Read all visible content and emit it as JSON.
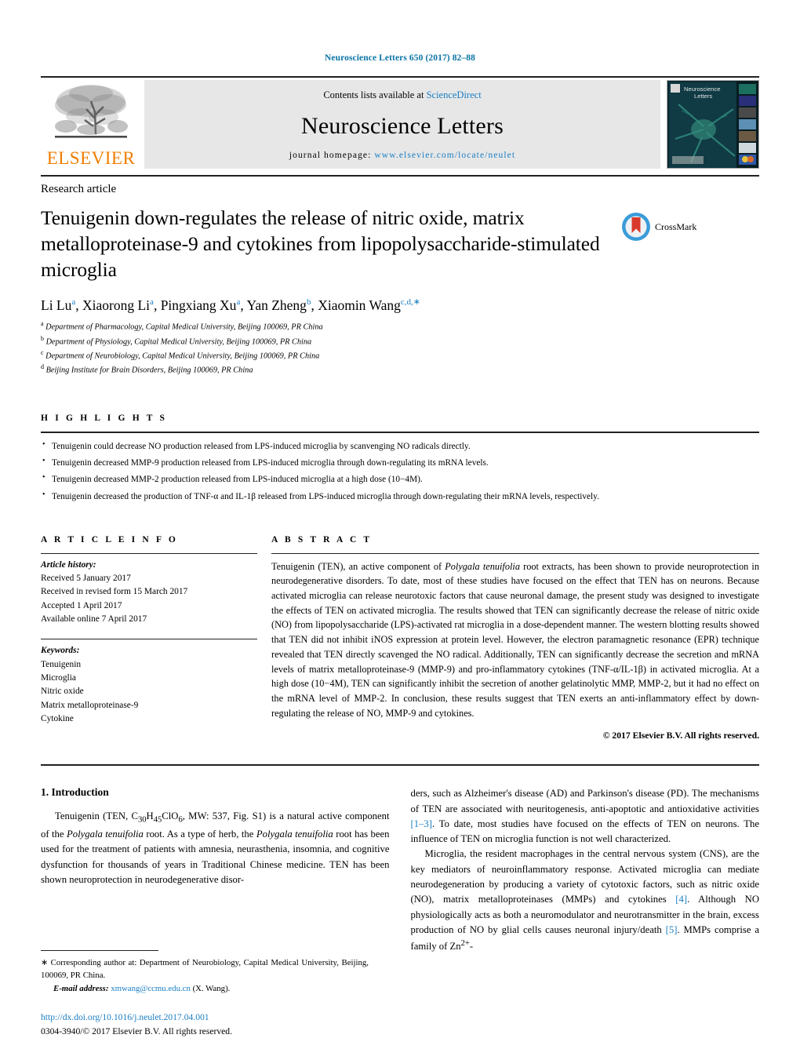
{
  "running_head": "Neuroscience Letters 650 (2017) 82–88",
  "masthead": {
    "publisher": "ELSEVIER",
    "contents_prefix": "Contents lists available at ",
    "contents_link": "ScienceDirect",
    "journal_title": "Neuroscience Letters",
    "homepage_label": "journal homepage: ",
    "homepage_url": "www.elsevier.com/locate/neulet",
    "cover_title_line1": "Neuroscience",
    "cover_title_line2": "Letters"
  },
  "article": {
    "type": "Research article",
    "title": "Tenuigenin down-regulates the release of nitric oxide, matrix metalloproteinase-9 and cytokines from lipopolysaccharide-stimulated microglia",
    "crossmark_label": "CrossMark",
    "authors": [
      {
        "name": "Li Lu",
        "sup": "a"
      },
      {
        "name": "Xiaorong Li",
        "sup": "a"
      },
      {
        "name": "Pingxiang Xu",
        "sup": "a"
      },
      {
        "name": "Yan Zheng",
        "sup": "b"
      },
      {
        "name": "Xiaomin Wang",
        "sup": "c,d,∗"
      }
    ],
    "affiliations": [
      {
        "mark": "a",
        "text": "Department of Pharmacology, Capital Medical University, Beijing 100069, PR China"
      },
      {
        "mark": "b",
        "text": "Department of Physiology, Capital Medical University, Beijing 100069, PR China"
      },
      {
        "mark": "c",
        "text": "Department of Neurobiology, Capital Medical University, Beijing 100069, PR China"
      },
      {
        "mark": "d",
        "text": "Beijing Institute for Brain Disorders, Beijing 100069, PR China"
      }
    ]
  },
  "highlights": {
    "heading": "H I G H L I G H T S",
    "items": [
      "Tenuigenin could decrease NO production released from LPS-induced microglia by scanvenging NO radicals directly.",
      "Tenuigenin decreased MMP-9 production released from LPS-induced microglia through down-regulating its mRNA levels.",
      "Tenuigenin decreased MMP-2 production released from LPS-induced microglia at a high dose (10−4M).",
      "Tenuigenin decreased the production of TNF-α and IL-1β released from LPS-induced microglia through down-regulating their mRNA levels, respectively."
    ]
  },
  "article_info": {
    "heading": "A R T I C L E   I N F O",
    "history_label": "Article history:",
    "history": [
      "Received 5 January 2017",
      "Received in revised form 15 March 2017",
      "Accepted 1 April 2017",
      "Available online 7 April 2017"
    ],
    "keywords_label": "Keywords:",
    "keywords": [
      "Tenuigenin",
      "Microglia",
      "Nitric oxide",
      "Matrix metalloproteinase-9",
      "Cytokine"
    ]
  },
  "abstract": {
    "heading": "A B S T R A C T",
    "text_part1": "Tenuigenin (TEN), an active component of ",
    "species": "Polygala tenuifolia",
    "text_part2": " root extracts, has been shown to provide neuroprotection in neurodegenerative disorders. To date, most of these studies have focused on the effect that TEN has on neurons. Because activated microglia can release neurotoxic factors that cause neuronal damage, the present study was designed to investigate the effects of TEN on activated microglia. The results showed that TEN can significantly decrease the release of nitric oxide (NO) from lipopolysaccharide (LPS)-activated rat microglia in a dose-dependent manner. The western blotting results showed that TEN did not inhibit iNOS expression at protein level. However, the electron paramagnetic resonance (EPR) technique revealed that TEN directly scavenged the NO radical. Additionally, TEN can significantly decrease the secretion and mRNA levels of matrix metalloproteinase-9 (MMP-9) and pro-inflammatory cytokines (TNF-α/IL-1β) in activated microglia. At a high dose (10−4M), TEN can significantly inhibit the secretion of another gelatinolytic MMP, MMP-2, but it had no effect on the mRNA level of MMP-2. In conclusion, these results suggest that TEN exerts an anti-inflammatory effect by down-regulating the release of NO, MMP-9 and cytokines.",
    "copyright": "© 2017 Elsevier B.V. All rights reserved."
  },
  "introduction": {
    "heading": "1.  Introduction",
    "left_p1_a": "Tenuigenin (TEN, C",
    "left_p1_sub1": "30",
    "left_p1_b": "H",
    "left_p1_sub2": "45",
    "left_p1_c": "ClO",
    "left_p1_sub3": "6",
    "left_p1_d": ", MW: 537, Fig. S1) is a natural active component of the ",
    "left_species1": "Polygala tenuifolia",
    "left_p1_e": " root. As a type of herb, the ",
    "left_species2": "Polygala tenuifolia",
    "left_p1_f": " root has been used for the treatment of patients with amnesia, neurasthenia, insomnia, and cognitive dysfunction for thousands of years in Traditional Chinese medicine. TEN has been shown neuroprotection in neurodegenerative disor-",
    "right_p1_a": "ders, such as Alzheimer's disease (AD) and Parkinson's disease (PD). The mechanisms of TEN are associated with neuritogenesis, anti-apoptotic and antioxidative activities ",
    "right_cite1": "[1–3]",
    "right_p1_b": ". To date, most studies have focused on the effects of TEN on neurons. The influence of TEN on microglia function is not well characterized.",
    "right_p2_a": "Microglia, the resident macrophages in the central nervous system (CNS), are the key mediators of neuroinflammatory response. Activated microglia can mediate neurodegeneration by producing a variety of cytotoxic factors, such as nitric oxide (NO), matrix metalloproteinases (MMPs) and cytokines ",
    "right_cite2": "[4]",
    "right_p2_b": ". Although NO physiologically acts as both a neuromodulator and neurotransmitter in the brain, excess production of NO by glial cells causes neuronal injury/death ",
    "right_cite3": "[5]",
    "right_p2_c": ". MMPs comprise a family of Zn",
    "right_p2_sup": "2+",
    "right_p2_d": "-"
  },
  "footer": {
    "corresponding_star": "∗",
    "corresponding": " Corresponding author at: Department of Neurobiology, Capital Medical University, Beijing, 100069, PR China.",
    "email_label": "E-mail address:",
    "email": "xmwang@ccmu.edu.cn",
    "email_suffix": " (X. Wang).",
    "doi": "http://dx.doi.org/10.1016/j.neulet.2017.04.001",
    "issn": "0304-3940/© 2017 Elsevier B.V. All rights reserved."
  },
  "colors": {
    "link": "#1a7ec4",
    "running_head": "#0a74a6",
    "elsevier_orange": "#ef7d00",
    "banner_bg": "#e7e7e7"
  }
}
